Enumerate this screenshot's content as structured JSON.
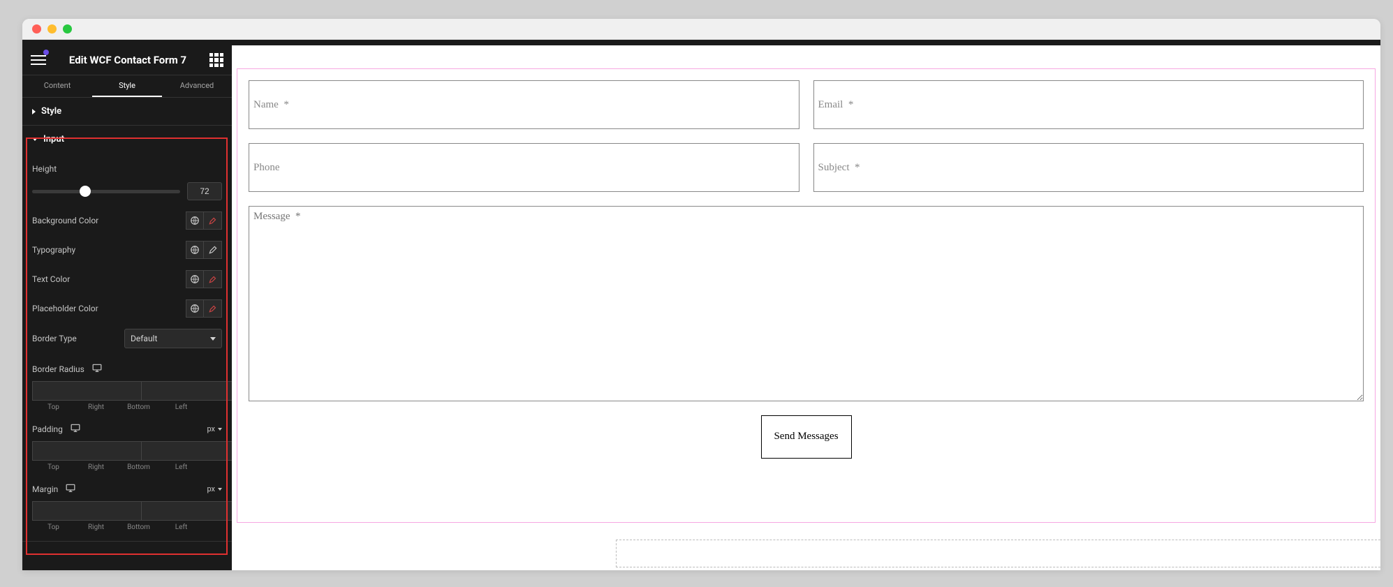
{
  "header": {
    "title": "Edit WCF Contact Form 7"
  },
  "tabs": {
    "content": "Content",
    "style": "Style",
    "advanced": "Advanced"
  },
  "sections": {
    "style": "Style",
    "input": "Input"
  },
  "controls": {
    "height": {
      "label": "Height",
      "value": "72"
    },
    "backgroundColor": {
      "label": "Background Color"
    },
    "typography": {
      "label": "Typography"
    },
    "textColor": {
      "label": "Text Color"
    },
    "placeholderColor": {
      "label": "Placeholder Color"
    },
    "borderType": {
      "label": "Border Type",
      "value": "Default"
    },
    "borderRadius": {
      "label": "Border Radius"
    },
    "padding": {
      "label": "Padding",
      "unit": "px"
    },
    "margin": {
      "label": "Margin",
      "unit": "px"
    }
  },
  "dimLabels": {
    "top": "Top",
    "right": "Right",
    "bottom": "Bottom",
    "left": "Left"
  },
  "form": {
    "name": "Name  *",
    "email": "Email  *",
    "phone": "Phone",
    "subject": "Subject  *",
    "message": "Message  *",
    "submit": "Send Messages"
  }
}
